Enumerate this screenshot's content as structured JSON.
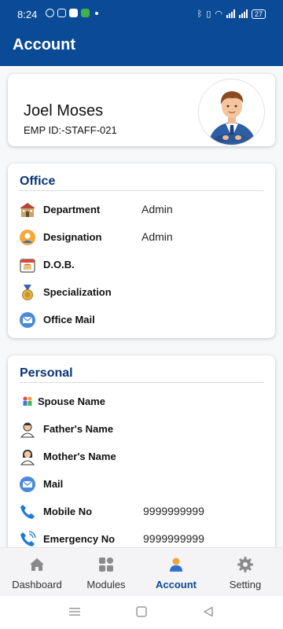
{
  "status_bar": {
    "time": "8:24",
    "battery": "27"
  },
  "app_bar": {
    "title": "Account"
  },
  "profile": {
    "name": "Joel Moses",
    "emp_id": "EMP ID:-STAFF-021"
  },
  "office": {
    "title": "Office",
    "rows": [
      {
        "label": "Department",
        "value": "Admin",
        "icon": "building-icon"
      },
      {
        "label": "Designation",
        "value": "Admin",
        "icon": "person-icon"
      },
      {
        "label": "D.O.B.",
        "value": "",
        "icon": "calendar-icon"
      },
      {
        "label": "Specialization",
        "value": "",
        "icon": "medal-icon"
      },
      {
        "label": "Office Mail",
        "value": "",
        "icon": "mail-icon"
      }
    ]
  },
  "personal": {
    "title": "Personal",
    "rows": [
      {
        "label": "Spouse Name",
        "value": "",
        "icon": "family-icon"
      },
      {
        "label": "Father's Name",
        "value": "",
        "icon": "father-icon"
      },
      {
        "label": "Mother's Name",
        "value": "",
        "icon": "mother-icon"
      },
      {
        "label": "Mail",
        "value": "",
        "icon": "mail-icon"
      },
      {
        "label": "Mobile No",
        "value": "9999999999",
        "icon": "phone-icon"
      },
      {
        "label": "Emergency No",
        "value": "9999999999",
        "icon": "emergency-phone-icon"
      }
    ]
  },
  "bottom_nav": {
    "items": [
      {
        "label": "Dashboard",
        "icon": "home-icon",
        "active": false
      },
      {
        "label": "Modules",
        "icon": "grid-icon",
        "active": false
      },
      {
        "label": "Account",
        "icon": "account-icon",
        "active": true
      },
      {
        "label": "Setting",
        "icon": "gear-icon",
        "active": false
      }
    ]
  },
  "colors": {
    "primary": "#0a4a96",
    "section_title": "#0b3576",
    "nav_active": "#0a4a96"
  }
}
